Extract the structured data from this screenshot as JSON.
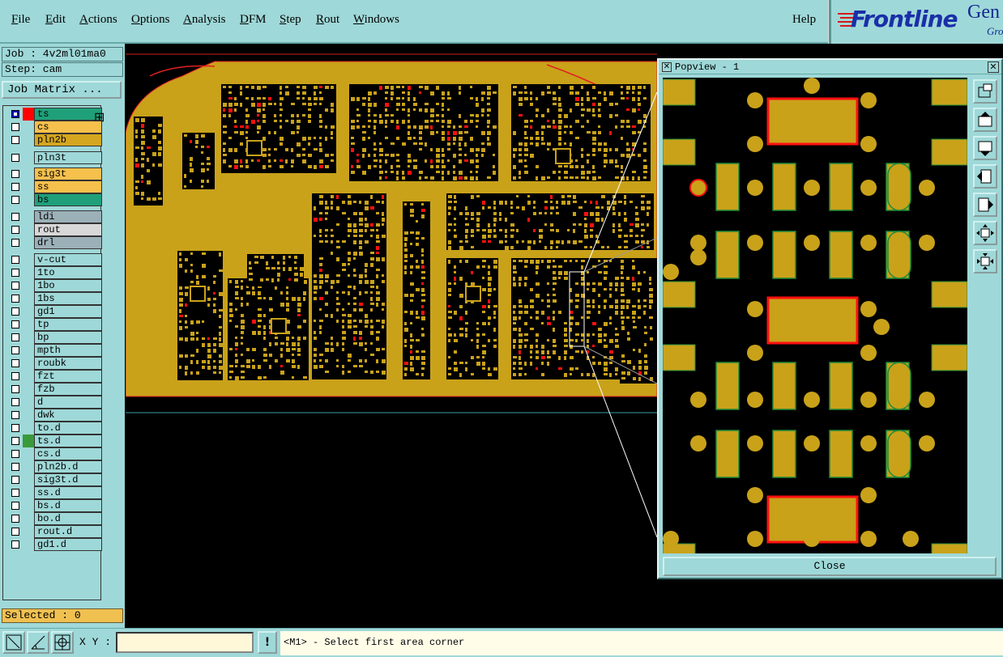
{
  "menubar": {
    "items": [
      "File",
      "Edit",
      "Actions",
      "Options",
      "Analysis",
      "DFM",
      "Step",
      "Rout",
      "Windows"
    ],
    "help": "Help",
    "logo_text": "Frontline",
    "logo_product": "Gen",
    "logo_sub": "Gro"
  },
  "job": {
    "label": "Job : 4v2ml01ma0",
    "step": "Step: cam"
  },
  "job_matrix_button": "Job Matrix ...",
  "layers": [
    {
      "name": "ts",
      "checked": true,
      "color": "#1fa07a",
      "swatch": "#ff0000",
      "tick": "⊞"
    },
    {
      "name": "cs",
      "checked": false,
      "color": "#f5c04c",
      "swatch": ""
    },
    {
      "name": "pln2b",
      "checked": false,
      "color": "#d4a620",
      "swatch": ""
    },
    {
      "name": "pln3t",
      "checked": false,
      "color": "#9fd8d8",
      "swatch": ""
    },
    {
      "name": "sig3t",
      "checked": false,
      "color": "#f5c04c",
      "swatch": ""
    },
    {
      "name": "ss",
      "checked": false,
      "color": "#f5c04c",
      "swatch": ""
    },
    {
      "name": "bs",
      "checked": false,
      "color": "#1fa07a",
      "swatch": ""
    },
    {
      "name": "ldi",
      "checked": false,
      "color": "#9cb0b8",
      "swatch": ""
    },
    {
      "name": "rout",
      "checked": false,
      "color": "#d8d8d8",
      "swatch": ""
    },
    {
      "name": "drl",
      "checked": false,
      "color": "#9cb0b8",
      "swatch": ""
    },
    {
      "name": "v-cut",
      "checked": false,
      "color": "#9fd8d8",
      "swatch": ""
    },
    {
      "name": "1to",
      "checked": false,
      "color": "#9fd8d8",
      "swatch": ""
    },
    {
      "name": "1bo",
      "checked": false,
      "color": "#9fd8d8",
      "swatch": ""
    },
    {
      "name": "1bs",
      "checked": false,
      "color": "#9fd8d8",
      "swatch": ""
    },
    {
      "name": "gd1",
      "checked": false,
      "color": "#9fd8d8",
      "swatch": ""
    },
    {
      "name": "tp",
      "checked": false,
      "color": "#9fd8d8",
      "swatch": ""
    },
    {
      "name": "bp",
      "checked": false,
      "color": "#9fd8d8",
      "swatch": ""
    },
    {
      "name": "mpth",
      "checked": false,
      "color": "#9fd8d8",
      "swatch": ""
    },
    {
      "name": "roubk",
      "checked": false,
      "color": "#9fd8d8",
      "swatch": ""
    },
    {
      "name": "fzt",
      "checked": false,
      "color": "#9fd8d8",
      "swatch": ""
    },
    {
      "name": "fzb",
      "checked": false,
      "color": "#9fd8d8",
      "swatch": ""
    },
    {
      "name": "d",
      "checked": false,
      "color": "#9fd8d8",
      "swatch": ""
    },
    {
      "name": "dwk",
      "checked": false,
      "color": "#9fd8d8",
      "swatch": ""
    },
    {
      "name": "to.d",
      "checked": false,
      "color": "#9fd8d8",
      "swatch": ""
    },
    {
      "name": "ts.d",
      "checked": false,
      "color": "#9fd8d8",
      "swatch": "#3a9a3a"
    },
    {
      "name": "cs.d",
      "checked": false,
      "color": "#9fd8d8",
      "swatch": ""
    },
    {
      "name": "pln2b.d",
      "checked": false,
      "color": "#9fd8d8",
      "swatch": ""
    },
    {
      "name": "sig3t.d",
      "checked": false,
      "color": "#9fd8d8",
      "swatch": ""
    },
    {
      "name": "ss.d",
      "checked": false,
      "color": "#9fd8d8",
      "swatch": ""
    },
    {
      "name": "bs.d",
      "checked": false,
      "color": "#9fd8d8",
      "swatch": ""
    },
    {
      "name": "bo.d",
      "checked": false,
      "color": "#9fd8d8",
      "swatch": ""
    },
    {
      "name": "rout.d",
      "checked": false,
      "color": "#9fd8d8",
      "swatch": ""
    },
    {
      "name": "gd1.d",
      "checked": false,
      "color": "#9fd8d8",
      "swatch": ""
    }
  ],
  "selected": "Selected : 0",
  "popview": {
    "title": "Popview - 1",
    "close_button": "Close"
  },
  "statusbar": {
    "xy_label": "X Y :",
    "xy_value": "",
    "warn": "!",
    "prompt": "<M1> - Select first area corner"
  },
  "colors": {
    "copper": "#c9a21a",
    "pad_outline": "#1f8a3a",
    "highlight": "#ff1010",
    "panel": "#9fd8d8",
    "background": "#000000"
  }
}
